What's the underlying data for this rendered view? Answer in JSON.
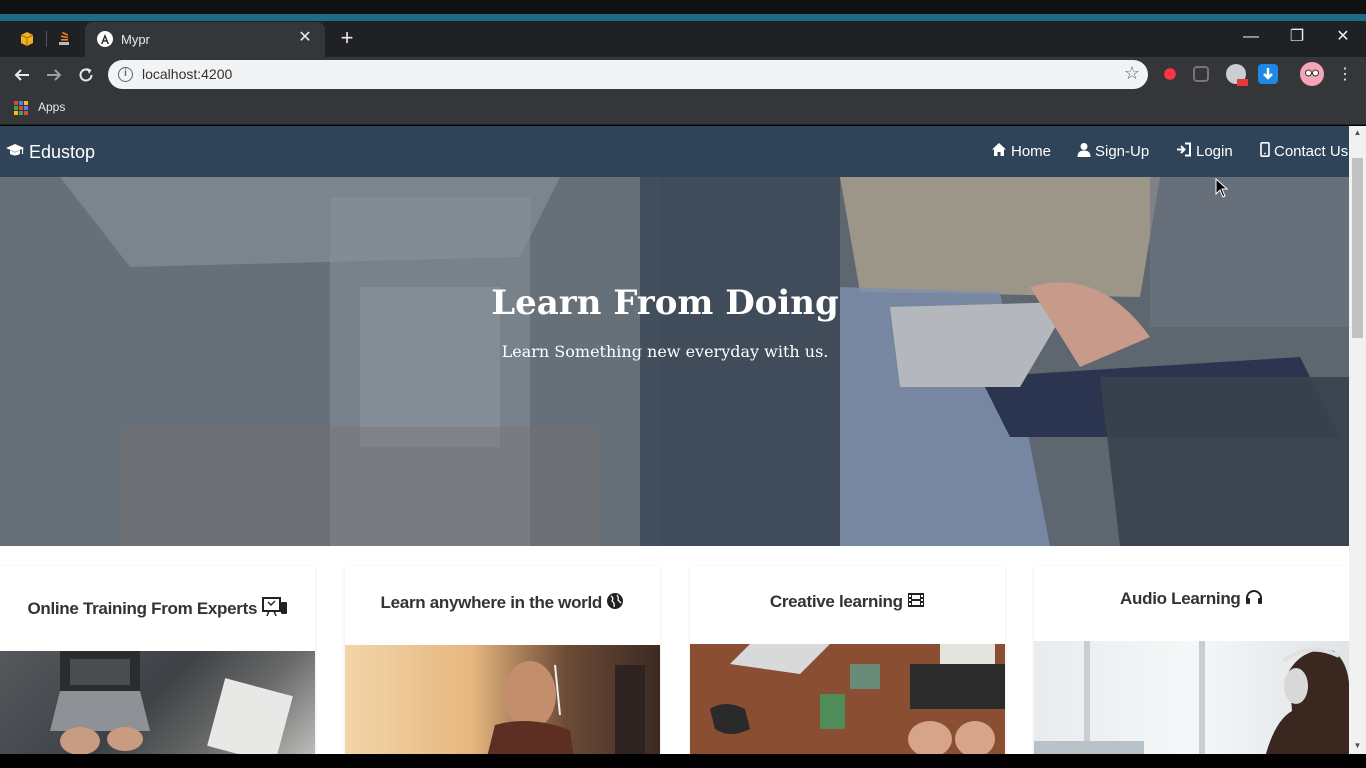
{
  "browser": {
    "tab_title": "Mypr",
    "url": "localhost:4200",
    "bookmarks_label": "Apps",
    "new_tab": "+",
    "tab_close": "✕",
    "window_controls": {
      "minimize": "—",
      "restore": "❐",
      "close": "✕"
    }
  },
  "site": {
    "brand": "Edustop",
    "nav": {
      "home": "Home",
      "signup": "Sign-Up",
      "login": "Login",
      "contact": "Contact Us"
    },
    "hero": {
      "title": "Learn From Doing",
      "subtitle": "Learn Something new everyday with us."
    },
    "cards": [
      {
        "title": "Online Training From Experts",
        "icon": "presentation-icon"
      },
      {
        "title": "Learn anywhere in the world",
        "icon": "globe-icon"
      },
      {
        "title": "Creative learning",
        "icon": "film-icon"
      },
      {
        "title": "Audio Learning",
        "icon": "headphones-icon"
      }
    ]
  },
  "colors": {
    "navbar": "#2f4459",
    "tab_active": "#35363a",
    "tabbar": "#202124",
    "accent_strip": "#1f6b86"
  }
}
